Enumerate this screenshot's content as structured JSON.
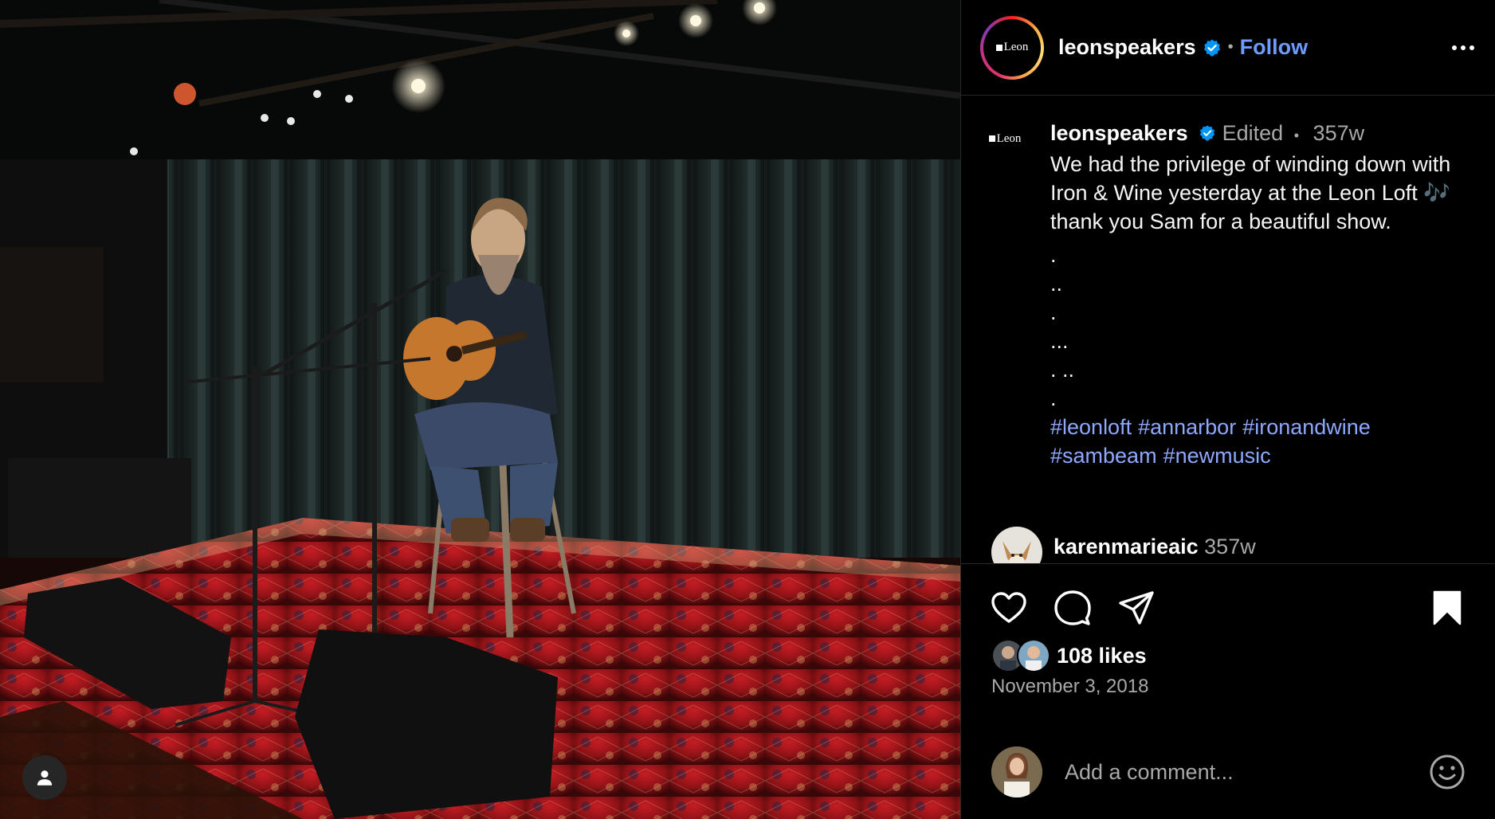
{
  "post": {
    "username": "leonspeakers",
    "follow_label": "Follow",
    "separator": "•",
    "brand_text": "Leon"
  },
  "caption": {
    "username": "leonspeakers",
    "edited": "Edited",
    "bullet": "•",
    "age": "357w",
    "text": "We had the privilege of winding down with Iron & Wine yesterday at the Leon Loft 🎶 thank you Sam for a beautiful show.",
    "filler_lines": ".\n..\n.\n...\n. ..\n.",
    "hashtags": [
      "#leonloft",
      "#annarbor",
      "#ironandwine",
      "#sambeam",
      "#newmusic"
    ]
  },
  "comments": [
    {
      "username": "karenmarieaic",
      "age": "357w"
    }
  ],
  "engagement": {
    "likes": "108 likes",
    "date": "November 3, 2018"
  },
  "comment_box": {
    "placeholder": "Add a comment..."
  },
  "colors": {
    "link": "#6d9bff",
    "hashtag": "#8fa8ff",
    "verified": "#0095f6",
    "background": "#000000",
    "muted": "#a8a8a8"
  },
  "icons": [
    "heart-icon",
    "comment-icon",
    "share-icon",
    "bookmark-icon",
    "emoji-icon",
    "more-icon",
    "verified-badge-icon",
    "user-tag-icon"
  ]
}
